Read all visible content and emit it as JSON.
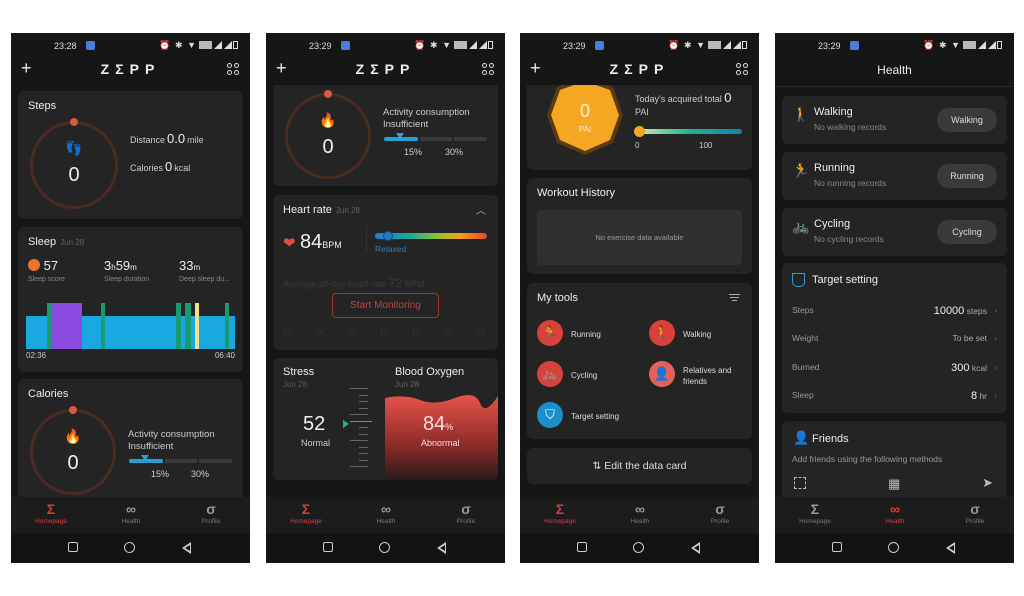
{
  "colors": {
    "accent": "#e03a3a",
    "blue": "#2a9fd6",
    "pai": "#f5a623",
    "card": "#242424",
    "background": "#161616"
  },
  "status_bar": {
    "times": [
      "23:28",
      "23:29",
      "23:29",
      "23:29"
    ]
  },
  "app": {
    "logo": "ZΣPP",
    "plus_icon": "+",
    "health_title": "Health"
  },
  "tabs": [
    {
      "label": "Homepage",
      "icon": "sigma-icon",
      "glyph": "Σ"
    },
    {
      "label": "Health",
      "icon": "health-icon",
      "glyph": "ఌ"
    },
    {
      "label": "Profile",
      "icon": "profile-icon",
      "glyph": "σ"
    }
  ],
  "screen1": {
    "steps": {
      "title": "Steps",
      "value": "0",
      "distance_label": "Distance",
      "distance_value": "0.0",
      "distance_unit": "mile",
      "calories_label": "Calories",
      "calories_value": "0",
      "calories_unit": "kcal"
    },
    "sleep": {
      "title": "Sleep",
      "date": "Jun 28",
      "score_value": "57",
      "score_label": "Sleep score",
      "duration_h": "3",
      "duration_m": "59",
      "duration_label": "Sleep duration",
      "deep_m": "33",
      "deep_label": "Deep sleep du...",
      "unit_h": "h",
      "unit_m": "m",
      "start_time": "02:36",
      "end_time": "06:40",
      "stages": [
        {
          "type": "light",
          "start": 0.0,
          "end": 1.0
        },
        {
          "type": "rem",
          "start": 0.12,
          "end": 0.27
        },
        {
          "type": "awake-green",
          "start": 0.1,
          "end": 0.12
        },
        {
          "type": "awake-green",
          "start": 0.36,
          "end": 0.38
        },
        {
          "type": "awake-green",
          "start": 0.72,
          "end": 0.74
        },
        {
          "type": "awake-green",
          "start": 0.76,
          "end": 0.79
        },
        {
          "type": "awake-yellow",
          "start": 0.81,
          "end": 0.83
        },
        {
          "type": "awake-green",
          "start": 0.95,
          "end": 0.97
        }
      ]
    },
    "calories": {
      "title": "Calories",
      "value": "0",
      "activity_label": "Activity consumption",
      "status": "Insufficient",
      "progress_pct": 15,
      "mark1": "15%",
      "mark2": "30%"
    }
  },
  "screen2": {
    "calories": {
      "value": "0",
      "activity_label": "Activity consumption",
      "status": "Insufficient",
      "progress_pct": 15,
      "mark1": "15%",
      "mark2": "30%"
    },
    "heart_rate": {
      "title": "Heart rate",
      "date": "Jun 28",
      "value": "84",
      "unit": "BPM",
      "zone": "Relaxed",
      "average_label": "Average all-day heart rate",
      "average_value": "72",
      "average_unit": "BPM",
      "button": "Start Monitoring",
      "axis": [
        "00",
        "04",
        "08",
        "12",
        "16",
        "20",
        "24"
      ]
    },
    "stress": {
      "title": "Stress",
      "date": "Jun 28",
      "value": "52",
      "status": "Normal"
    },
    "blood_oxygen": {
      "title": "Blood Oxygen",
      "date": "Jun 28",
      "value": "84",
      "unit": "%",
      "status": "Abnormal"
    }
  },
  "screen3": {
    "pai": {
      "value": "0",
      "label": "PAI",
      "today_label": "Today's acquired total",
      "today_value": "0",
      "today_unit": "PAI",
      "scale_min": "0",
      "scale_max": "100"
    },
    "workout": {
      "title": "Workout History",
      "empty": "No exercise data available"
    },
    "tools": {
      "title": "My tools",
      "items": [
        {
          "label": "Running",
          "icon": "running-icon",
          "glyph": "🏃"
        },
        {
          "label": "Walking",
          "icon": "walking-icon",
          "glyph": "🚶"
        },
        {
          "label": "Cycling",
          "icon": "cycling-icon",
          "glyph": "🚲"
        },
        {
          "label": "Relatives and friends",
          "icon": "friends-icon",
          "glyph": "👤"
        },
        {
          "label": "Target setting",
          "icon": "target-icon",
          "glyph": "⛉"
        }
      ]
    },
    "edit_card": "Edit the data card"
  },
  "screen4": {
    "activities": [
      {
        "name": "Walking",
        "subtitle": "No walking records",
        "button": "Walking",
        "color": "#2a9fd6",
        "glyph": "🚶"
      },
      {
        "name": "Running",
        "subtitle": "No running records",
        "button": "Running",
        "color": "#1fb58a",
        "glyph": "🏃"
      },
      {
        "name": "Cycling",
        "subtitle": "No cycling records",
        "button": "Cycling",
        "color": "#e03a3a",
        "glyph": "🚲"
      }
    ],
    "target": {
      "title": "Target setting",
      "rows": [
        {
          "label": "Steps",
          "value": "10000",
          "unit": "steps"
        },
        {
          "label": "Weight",
          "value": "",
          "unit": "To be set"
        },
        {
          "label": "Burned",
          "value": "300",
          "unit": "kcal"
        },
        {
          "label": "Sleep",
          "value": "8",
          "unit": "hr"
        }
      ]
    },
    "friends": {
      "title": "Friends",
      "subtitle": "Add friends using the following methods"
    }
  }
}
